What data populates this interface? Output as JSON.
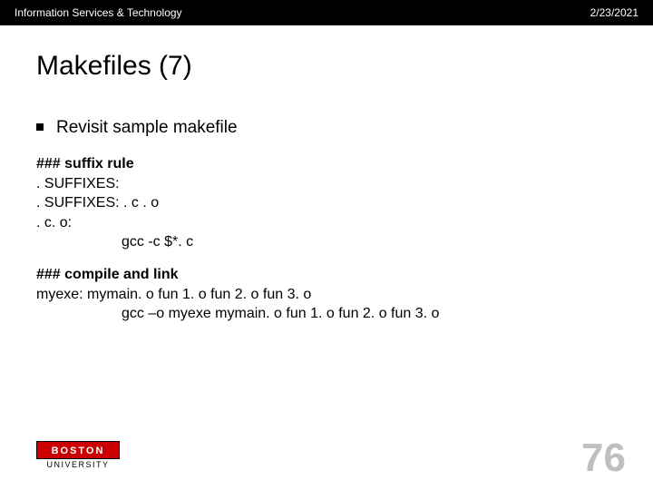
{
  "header": {
    "left": "Information Services & Technology",
    "right": "2/23/2021"
  },
  "title": "Makefiles (7)",
  "bullet": "Revisit sample makefile",
  "code": {
    "l1": "### suffix rule",
    "l2": ". SUFFIXES:",
    "l3": ". SUFFIXES: . c . o",
    "l4": ". c. o:",
    "l5": "gcc  -c   $*. c",
    "l6": "### compile and link",
    "l7": "myexe:  mymain. o   fun 1. o   fun 2. o   fun 3. o",
    "l8": "gcc  –o   myexe  mymain. o   fun 1. o   fun 2. o   fun 3. o"
  },
  "logo": {
    "top": "BOSTON",
    "bottom": "UNIVERSITY"
  },
  "page_number": "76"
}
